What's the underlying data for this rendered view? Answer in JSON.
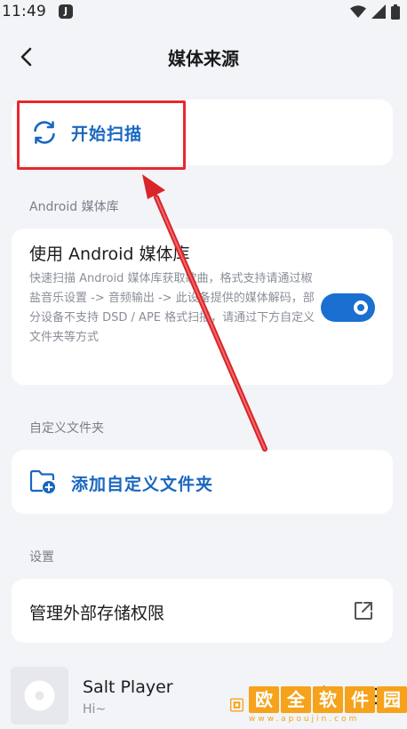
{
  "status_bar": {
    "time": "11:49",
    "app_badge": "J"
  },
  "header": {
    "title": "媒体来源"
  },
  "scan": {
    "label": "开始扫描"
  },
  "android_section": {
    "heading": "Android 媒体库",
    "title": "使用 Android 媒体库",
    "description": "快速扫描 Android 媒体库获取歌曲，格式支持请通过椒盐音乐设置 -> 音频输出 -> 此设备提供的媒体解码，部分设备不支持 DSD / APE 格式扫描，请通过下方自定义文件夹等方式",
    "toggle_on": true
  },
  "folder_section": {
    "heading": "自定义文件夹",
    "add_label": "添加自定义文件夹"
  },
  "settings_section": {
    "heading": "设置",
    "storage_label": "管理外部存储权限"
  },
  "player": {
    "title": "Salt Player",
    "subtitle": "Hi~"
  },
  "watermark": {
    "chars": [
      "欧",
      "全",
      "软",
      "件",
      "园"
    ],
    "url": "www.apoujin.com"
  },
  "colors": {
    "accent": "#1967c0",
    "toggle": "#1a6fd1",
    "highlight": "#e8282c",
    "background": "#f2f4f8"
  }
}
